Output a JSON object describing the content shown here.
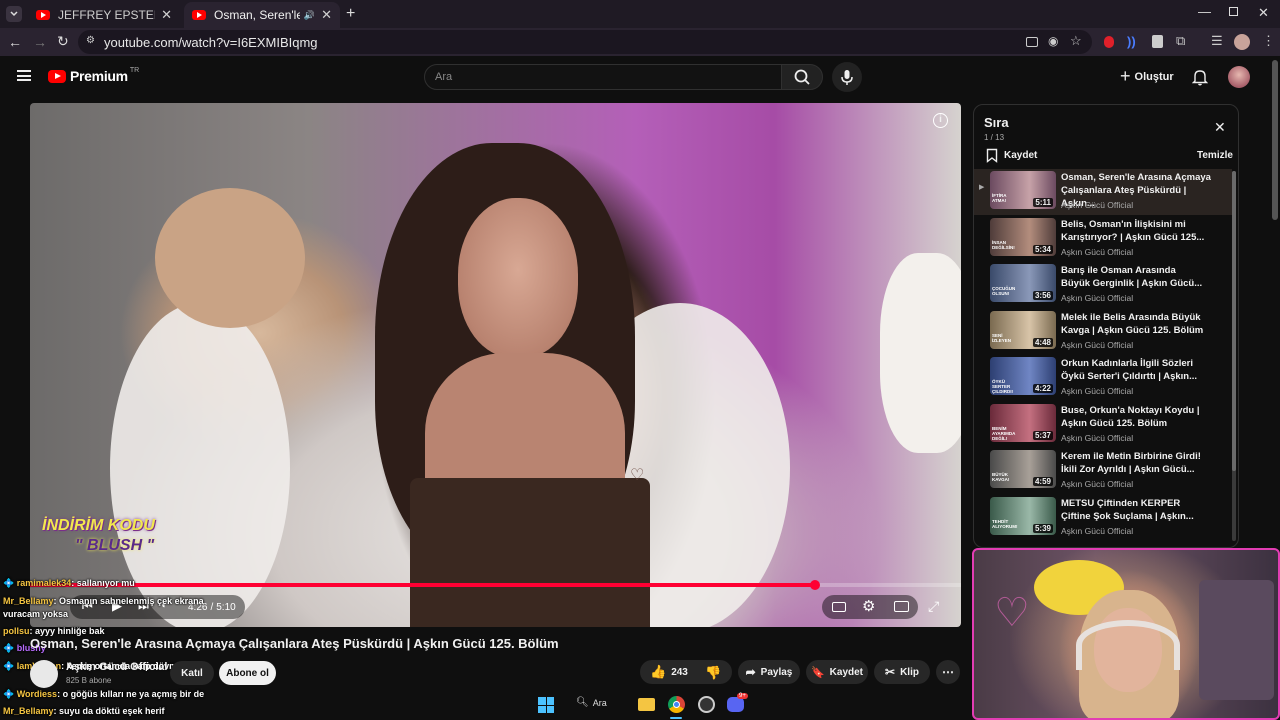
{
  "browser": {
    "tabs": [
      {
        "title": "JEFFREY EPSTEIN'IN ADASINA G",
        "active": false
      },
      {
        "title": "Osman, Seren'le Arasına Aç",
        "active": true
      }
    ],
    "url": "youtube.com/watch?v=I6EXMIBIqmg"
  },
  "header": {
    "logo_text": "Premium",
    "logo_badge": "TR",
    "search_placeholder": "Ara",
    "create_label": "Oluştur"
  },
  "video": {
    "time_current": "4:26",
    "time_separator": "/",
    "time_total": "5:10",
    "progress": 0.843,
    "overlay_line1": "İNDİRİM KODU",
    "overlay_line2": "\" BLUSH \""
  },
  "chat": [
    {
      "user": "ramimalek34",
      "text": ": sallanıyor mu",
      "color": "#f5c542"
    },
    {
      "user": "Mr_Bellamy",
      "text": ": Osmanın sahnelenmiş çek ekrana vuracam yoksa",
      "color": "#f5c542"
    },
    {
      "user": "pollsu",
      "text": ": ayyy hinliğe bak",
      "color": "#f5c542"
    },
    {
      "user": "blushy",
      "text": "",
      "color": "#b86cff"
    },
    {
      "user": "IamVolkan",
      "text": ": kemiş ortamda kalp dövmesi var",
      "color": "#f5c542"
    },
    {
      "user": "Wordiess",
      "text": ": o göğüs kılları ne ya açmış bir de",
      "color": "#f5c542"
    },
    {
      "user": "Mr_Bellamy",
      "text": ": suyu da döktü eşek herif",
      "color": "#f5c542"
    }
  ],
  "details": {
    "title": "Osman, Seren'le Arasına Açmaya Çalışanlara Ateş Püskürdü | Aşkın Gücü 125. Bölüm",
    "channel": "Aşkın Gücü Official",
    "subscribers": "825 B abone",
    "join_label": "Katıl",
    "subscribe_label": "Abone ol",
    "likes": "243",
    "share_label": "Paylaş",
    "save_label": "Kaydet",
    "clip_label": "Klip"
  },
  "queue": {
    "title": "Sıra",
    "position": "1 / 13",
    "save_label": "Kaydet",
    "clear_label": "Temizle",
    "items": [
      {
        "title_line1": "Osman, Seren'le Arasına Açmaya",
        "title_line2": "Çalışanlara Ateş Püskürdü | Aşkın...",
        "channel": "Aşkın Gücü Official",
        "duration": "5:11",
        "badge": "İFTİRA ATMA!",
        "color1": "#6b4a60",
        "color2": "#c7a2a8"
      },
      {
        "title_line1": "Belis, Osman'ın İlişkisini mi",
        "title_line2": "Karıştırıyor? | Aşkın Gücü 125...",
        "channel": "Aşkın Gücü Official",
        "duration": "5:34",
        "badge": "İNSAN DEĞİLSİN!",
        "color1": "#4f3c3a",
        "color2": "#b38d7d"
      },
      {
        "title_line1": "Barış ile Osman Arasında",
        "title_line2": "Büyük Gerginlik | Aşkın Gücü...",
        "channel": "Aşkın Gücü Official",
        "duration": "3:56",
        "badge": "ÇOCUĞUN OLSUN!",
        "color1": "#3a4a6a",
        "color2": "#8a98b8"
      },
      {
        "title_line1": "Melek ile Belis Arasında Büyük",
        "title_line2": "Kavga | Aşkın Gücü 125. Bölüm",
        "channel": "Aşkın Gücü Official",
        "duration": "4:48",
        "badge": "SENİ İZLEYEN",
        "color1": "#7a6a50",
        "color2": "#d8c4a8"
      },
      {
        "title_line1": "Orkun Kadınlarla İlgili Sözleri",
        "title_line2": "Öykü Serter'i Çıldırttı | Aşkın...",
        "channel": "Aşkın Gücü Official",
        "duration": "4:22",
        "badge": "ÖYKÜ SERTER ÇILDIRDI!",
        "color1": "#2d3f72",
        "color2": "#7086c4"
      },
      {
        "title_line1": "Buse, Orkun'a Noktayı Koydu |",
        "title_line2": "Aşkın Gücü 125. Bölüm",
        "channel": "Aşkın Gücü Official",
        "duration": "5:37",
        "badge": "BENİM AYARIMDA DEĞİL!",
        "color1": "#6a2a3a",
        "color2": "#c47080"
      },
      {
        "title_line1": "Kerem ile Metin Birbirine Girdi!",
        "title_line2": "İkili Zor Ayrıldı | Aşkın Gücü...",
        "channel": "Aşkın Gücü Official",
        "duration": "4:59",
        "badge": "BÜYÜK KAVGA!",
        "color1": "#4a4a4a",
        "color2": "#a8a098"
      },
      {
        "title_line1": "METSU Çiftinden KERPER",
        "title_line2": "Çiftine Şok Suçlama | Aşkın...",
        "channel": "Aşkın Gücü Official",
        "duration": "5:39",
        "badge": "TEHDİT ALIYORUM!",
        "color1": "#3a5a4a",
        "color2": "#9ab8a8"
      }
    ]
  },
  "taskbar": {
    "search_label": "Ara",
    "discord_badge": "9+"
  },
  "colors": {
    "brand_red": "#ff0000",
    "progress_red": "#f03",
    "stream_border": "#e23db3"
  }
}
